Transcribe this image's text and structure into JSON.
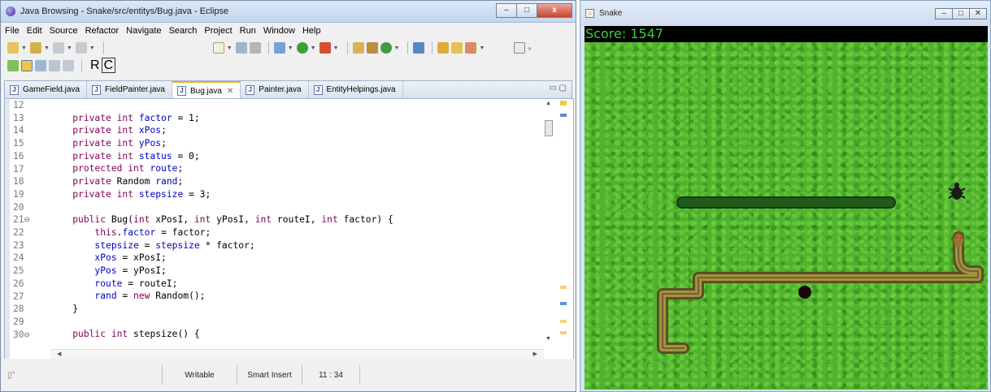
{
  "eclipse": {
    "title": "Java Browsing - Snake/src/entitys/Bug.java - Eclipse",
    "window_buttons": {
      "minimize": "–",
      "maximize": "□",
      "close": "x"
    },
    "menu": [
      "File",
      "Edit",
      "Source",
      "Refactor",
      "Navigate",
      "Search",
      "Project",
      "Run",
      "Window",
      "Help"
    ],
    "toolbar_text": {
      "r": "R",
      "c": "C"
    },
    "tabs": [
      {
        "label": "GameField.java",
        "active": false
      },
      {
        "label": "FieldPainter.java",
        "active": false
      },
      {
        "label": "Bug.java",
        "active": true
      },
      {
        "label": "Painter.java",
        "active": false
      },
      {
        "label": "EntityHelpings.java",
        "active": false
      }
    ],
    "code": {
      "line_numbers": [
        "12",
        "13",
        "14",
        "15",
        "16",
        "17",
        "18",
        "19",
        "20",
        "21⊖",
        "22",
        "23",
        "24",
        "25",
        "26",
        "27",
        "28",
        "29",
        "30⊖"
      ],
      "lines": [
        [],
        [
          {
            "t": "    "
          },
          {
            "t": "private int ",
            "c": "kw"
          },
          {
            "t": "factor",
            "c": "fld"
          },
          {
            "t": " = 1;"
          }
        ],
        [
          {
            "t": "    "
          },
          {
            "t": "private int ",
            "c": "kw"
          },
          {
            "t": "xPos",
            "c": "fld"
          },
          {
            "t": ";"
          }
        ],
        [
          {
            "t": "    "
          },
          {
            "t": "private int ",
            "c": "kw"
          },
          {
            "t": "yPos",
            "c": "fld"
          },
          {
            "t": ";"
          }
        ],
        [
          {
            "t": "    "
          },
          {
            "t": "private int ",
            "c": "kw"
          },
          {
            "t": "status",
            "c": "fld"
          },
          {
            "t": " = 0;"
          }
        ],
        [
          {
            "t": "    "
          },
          {
            "t": "protected int ",
            "c": "kw"
          },
          {
            "t": "route",
            "c": "fld"
          },
          {
            "t": ";"
          }
        ],
        [
          {
            "t": "    "
          },
          {
            "t": "private ",
            "c": "kw"
          },
          {
            "t": "Random "
          },
          {
            "t": "rand",
            "c": "fld"
          },
          {
            "t": ";"
          }
        ],
        [
          {
            "t": "    "
          },
          {
            "t": "private int ",
            "c": "kw"
          },
          {
            "t": "stepsize",
            "c": "fld"
          },
          {
            "t": " = 3;"
          }
        ],
        [],
        [
          {
            "t": "    "
          },
          {
            "t": "public ",
            "c": "kw"
          },
          {
            "t": "Bug("
          },
          {
            "t": "int ",
            "c": "kw"
          },
          {
            "t": "xPosI, "
          },
          {
            "t": "int ",
            "c": "kw"
          },
          {
            "t": "yPosI, "
          },
          {
            "t": "int ",
            "c": "kw"
          },
          {
            "t": "routeI, "
          },
          {
            "t": "int ",
            "c": "kw"
          },
          {
            "t": "factor) {"
          }
        ],
        [
          {
            "t": "        "
          },
          {
            "t": "this",
            "c": "kw"
          },
          {
            "t": "."
          },
          {
            "t": "factor",
            "c": "fld"
          },
          {
            "t": " = factor;"
          }
        ],
        [
          {
            "t": "        "
          },
          {
            "t": "stepsize",
            "c": "fld"
          },
          {
            "t": " = "
          },
          {
            "t": "stepsize",
            "c": "fld"
          },
          {
            "t": " * factor;"
          }
        ],
        [
          {
            "t": "        "
          },
          {
            "t": "xPos",
            "c": "fld"
          },
          {
            "t": " = xPosI;"
          }
        ],
        [
          {
            "t": "        "
          },
          {
            "t": "yPos",
            "c": "fld"
          },
          {
            "t": " = yPosI;"
          }
        ],
        [
          {
            "t": "        "
          },
          {
            "t": "route",
            "c": "fld"
          },
          {
            "t": " = routeI;"
          }
        ],
        [
          {
            "t": "        "
          },
          {
            "t": "rand",
            "c": "fld"
          },
          {
            "t": " = "
          },
          {
            "t": "new ",
            "c": "kw"
          },
          {
            "t": "Random();"
          }
        ],
        [
          {
            "t": "    }"
          }
        ],
        [],
        [
          {
            "t": "    "
          },
          {
            "t": "public int ",
            "c": "kw"
          },
          {
            "t": "stepsize() {"
          }
        ]
      ]
    },
    "status": {
      "writable": "Writable",
      "insert_mode": "Smart Insert",
      "position": "11 : 34"
    }
  },
  "snake": {
    "title": "Snake",
    "score": "Score: 1547",
    "colors": {
      "field": "#4fb32f",
      "score_text": "#36d236",
      "snake_body": "#8c7a35",
      "snake_head": "#9a7332",
      "obstacle": "#1f5a18",
      "hole": "#170606"
    }
  }
}
